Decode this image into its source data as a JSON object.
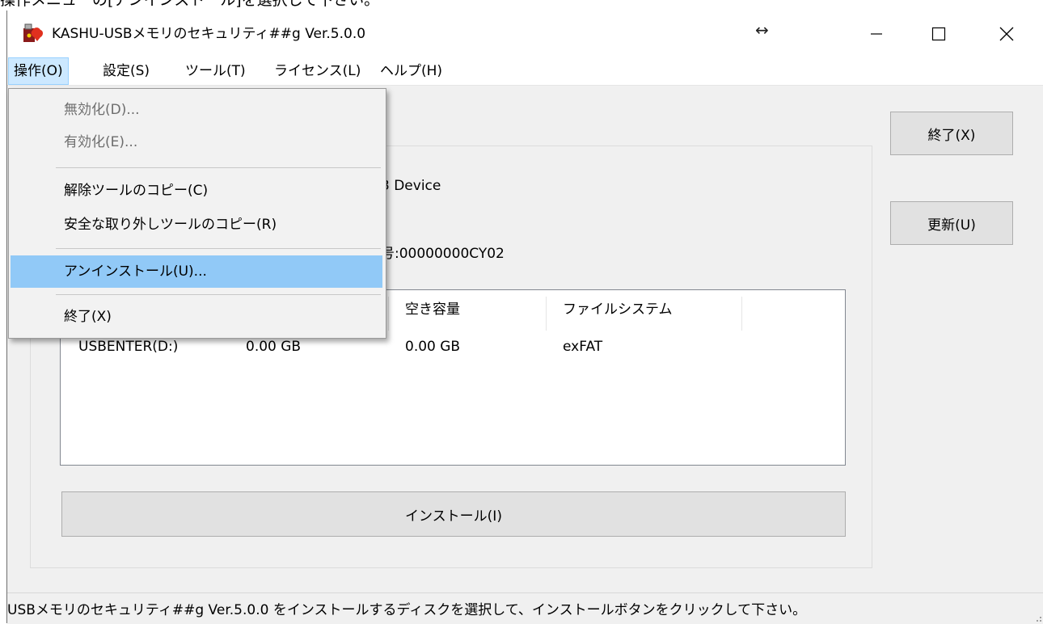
{
  "caption": "操作メニューの[アンインストール]を選択して下さい。",
  "window": {
    "title": "KASHU-USBメモリのセキュリティ##g Ver.5.0.0",
    "resize_indicator": "↔"
  },
  "menubar": {
    "items": [
      {
        "label": "操作(O)"
      },
      {
        "label": "設定(S)"
      },
      {
        "label": "ツール(T)"
      },
      {
        "label": "ライセンス(L)"
      },
      {
        "label": "ヘルプ(H)"
      }
    ]
  },
  "dropdown": {
    "items": [
      {
        "label": "無効化(D)...",
        "enabled": false
      },
      {
        "label": "有効化(E)...",
        "enabled": false
      },
      {
        "label": "解除ツールのコピー(C)",
        "enabled": true
      },
      {
        "label": "安全な取り外しツールのコピー(R)",
        "enabled": true
      },
      {
        "label": "アンインストール(U)...",
        "enabled": true,
        "highlighted": true
      },
      {
        "label": "終了(X)",
        "enabled": true
      }
    ]
  },
  "buttons": {
    "exit": "終了(X)",
    "refresh": "更新(U)",
    "install": "インストール(I)"
  },
  "device_info": {
    "device_name_partial": "3 Device",
    "serial_partial": "号:00000000CY02"
  },
  "disk_list": {
    "columns": [
      "空き容量",
      "ファイルシステム"
    ],
    "rows": [
      {
        "drive": "USBENTER(D:)",
        "capacity": "0.00 GB",
        "free": "0.00 GB",
        "fs": "exFAT"
      }
    ]
  },
  "status": "USBメモリのセキュリティ##g Ver.5.0.0 をインストールするディスクを選択して、インストールボタンをクリックして下さい。",
  "colors": {
    "menu_highlight": "#91c9f7",
    "menu_active": "#cce8ff",
    "window_bg": "#f0f0f0"
  }
}
